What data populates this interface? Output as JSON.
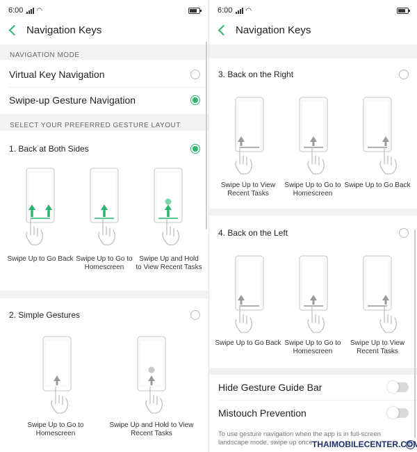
{
  "statusbar": {
    "time": "6:00"
  },
  "left": {
    "title": "Navigation Keys",
    "section_mode": "NAVIGATION MODE",
    "opt_virtual": "Virtual Key Navigation",
    "opt_swipe": "Swipe-up Gesture Navigation",
    "section_layout": "SELECT YOUR PREFERRED GESTURE LAYOUT",
    "layout1": {
      "title": "1. Back at Both Sides",
      "captions": [
        "Swipe Up to Go Back",
        "Swipe Up to Go to Homescreen",
        "Swipe Up and Hold to View Recent Tasks"
      ]
    },
    "layout2": {
      "title": "2. Simple Gestures",
      "captions": [
        "Swipe Up to Go to Homescreen",
        "Swipe Up and Hold to View Recent Tasks"
      ]
    }
  },
  "right": {
    "title": "Navigation Keys",
    "layout3": {
      "title": "3. Back on the Right",
      "captions": [
        "Swipe Up to View Recent Tasks",
        "Swipe Up to Go to Homescreen",
        "Swipe Up to Go Back"
      ]
    },
    "layout4": {
      "title": "4. Back on the Left",
      "captions": [
        "Swipe Up to Go Back",
        "Swipe Up to Go to Homescreen",
        "Swipe Up to View Recent Tasks"
      ]
    },
    "hide_bar": "Hide Gesture Guide Bar",
    "mistouch": "Mistouch Prevention",
    "description": "To use gesture navigation when the app is in full-screen landscape mode, swipe up once, then swipe up again."
  },
  "watermark": "THAIMOBILECENTER.COM",
  "watermark_logo": "©",
  "state": {
    "selected_mode": "swipe",
    "selected_layout": 1,
    "hide_bar": false,
    "mistouch": false
  },
  "colors": {
    "accent": "#2bb56e",
    "gray_arrow": "#9a9a9a",
    "section_bg": "#f2f2f2"
  },
  "icons": [
    "back-chevron-icon",
    "signal-icon",
    "wifi-icon",
    "battery-icon",
    "phone-illustration",
    "hand-icon",
    "swipe-arrow-icon"
  ]
}
